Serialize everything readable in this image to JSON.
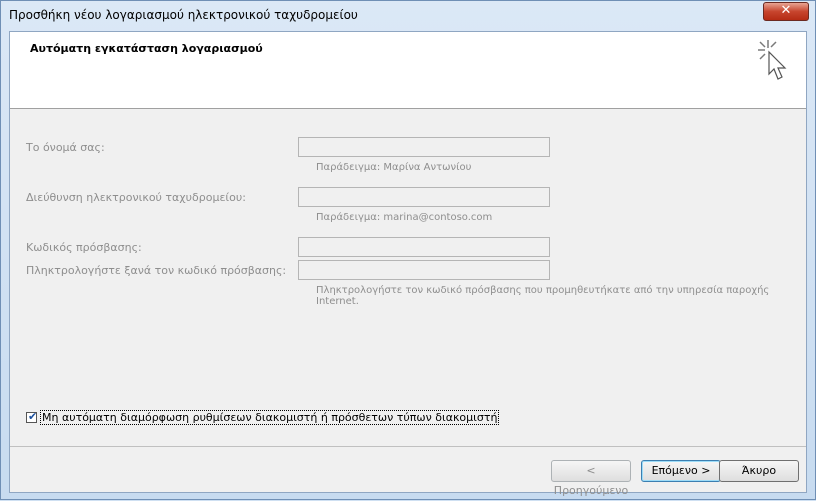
{
  "window": {
    "title": "Προσθήκη νέου λογαριασμού ηλεκτρονικού ταχυδρομείου",
    "close_label": "✕"
  },
  "header": {
    "title": "Αυτόματη εγκατάσταση λογαριασμού",
    "icon": "wizard-cursor-icon"
  },
  "form": {
    "name_label": "Το όνομά σας:",
    "name_value": "",
    "name_hint": "Παράδειγμα: Μαρίνα Αντωνίου",
    "email_label": "Διεύθυνση ηλεκτρονικού ταχυδρομείου:",
    "email_value": "",
    "email_hint": "Παράδειγμα: marina@contoso.com",
    "password_label": "Κωδικός πρόσβασης:",
    "password_value": "",
    "retype_label": "Πληκτρολογήστε ξανά τον κωδικό πρόσβασης:",
    "retype_value": "",
    "password_hint": "Πληκτρολογήστε τον κωδικό πρόσβασης που προμηθευτήκατε από την υπηρεσία παροχής Internet."
  },
  "options": {
    "manual_config_label": "Μη αυτόματη διαμόρφωση ρυθμίσεων διακομιστή ή πρόσθετων τύπων διακομιστή",
    "manual_config_checked": true
  },
  "buttons": {
    "back_label": "< Προηγούμενο",
    "next_label": "Επόμενο >",
    "cancel_label": "Άκυρο"
  },
  "colors": {
    "titlebar": "#cfe0f2",
    "close_button": "#c7452e",
    "disabled_text": "#8e8e8e"
  }
}
